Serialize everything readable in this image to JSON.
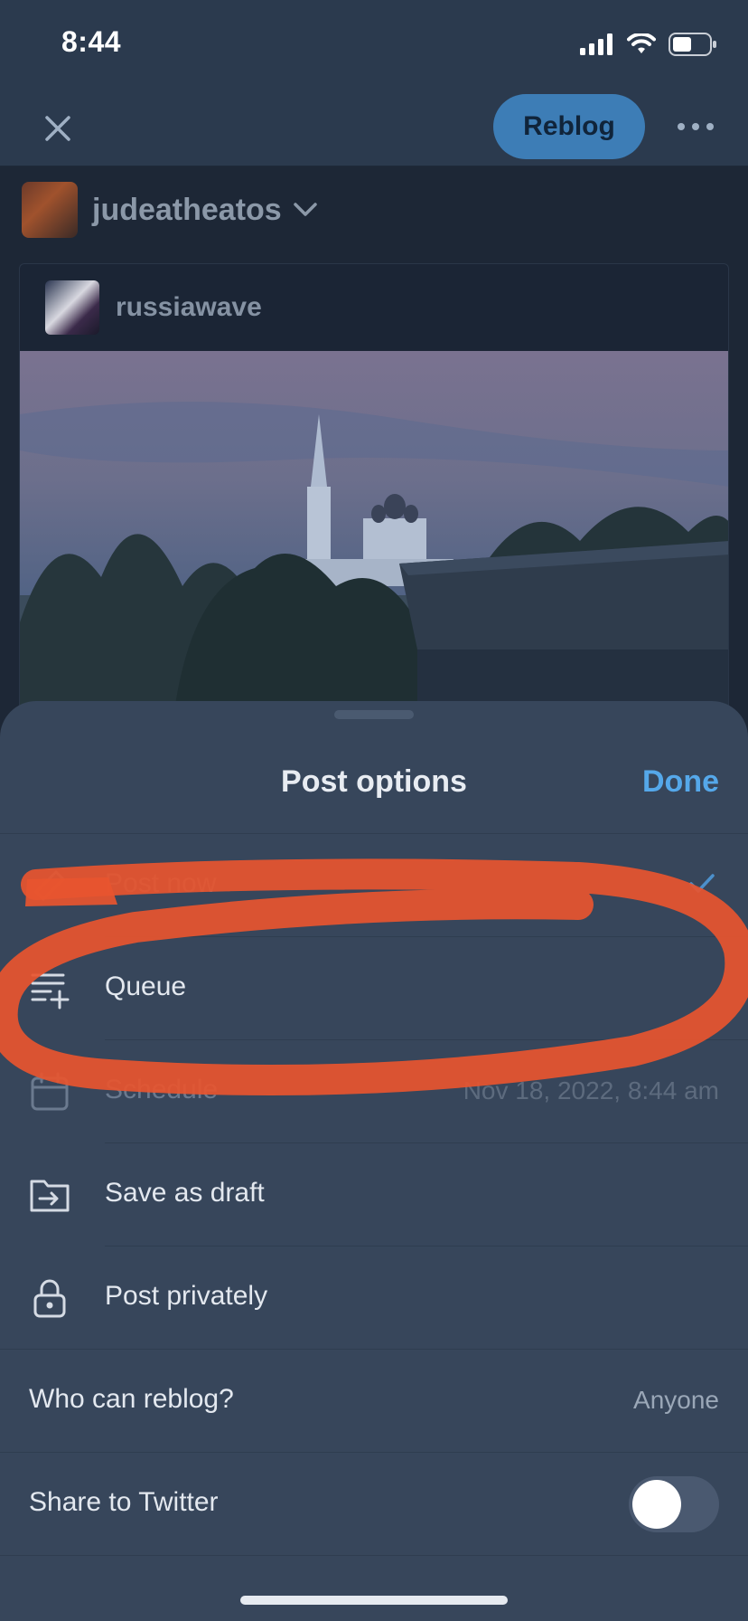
{
  "status_bar": {
    "time": "8:44"
  },
  "top_bar": {
    "reblog_label": "Reblog"
  },
  "blog": {
    "name": "judeatheatos"
  },
  "post": {
    "author": "russiawave"
  },
  "sheet": {
    "title": "Post options",
    "done_label": "Done",
    "options": [
      {
        "label": "Post now",
        "icon": "send-icon",
        "selected": true
      },
      {
        "label": "Queue",
        "icon": "queue-add-icon"
      },
      {
        "label": "Schedule",
        "icon": "calendar-icon",
        "value": "Nov 18, 2022, 8:44 am"
      },
      {
        "label": "Save as draft",
        "icon": "folder-arrow-icon"
      },
      {
        "label": "Post privately",
        "icon": "lock-icon"
      }
    ],
    "who_can_reblog": {
      "label": "Who can reblog?",
      "value": "Anyone"
    },
    "share_twitter": {
      "label": "Share to Twitter",
      "enabled": false
    }
  },
  "colors": {
    "accent": "#55a8ea",
    "reblog_button": "#3d7db6",
    "annotation": "#e8552f",
    "sheet_bg": "#37465b"
  }
}
